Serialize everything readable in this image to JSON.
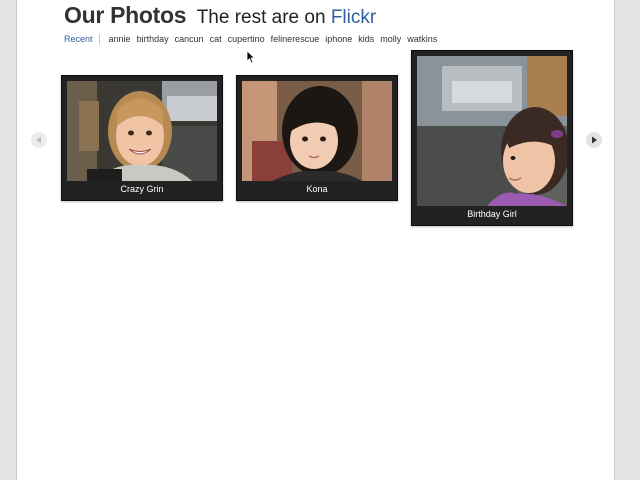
{
  "header": {
    "title": "Our Photos",
    "subtitle_prefix": "The rest are on",
    "link_label": "Flickr"
  },
  "tags": {
    "recent": "Recent",
    "items": [
      "annie",
      "birthday",
      "cancun",
      "cat",
      "cupertino",
      "felinerescue",
      "iphone",
      "kids",
      "molly",
      "watkins"
    ]
  },
  "carousel": {
    "prev_icon": "arrow-left-icon",
    "next_icon": "arrow-right-icon",
    "photos": [
      {
        "caption": "Crazy Grin"
      },
      {
        "caption": "Kona"
      },
      {
        "caption": "Birthday Girl"
      }
    ]
  },
  "colors": {
    "accent": "#2f5f9e",
    "card_bg": "#222222",
    "page_bg": "#ffffff",
    "window_bg": "#e4e4e4"
  }
}
